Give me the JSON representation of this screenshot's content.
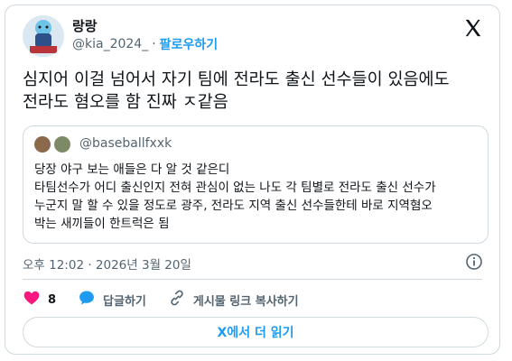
{
  "author": {
    "name": "랑랑",
    "handle": "@kia_2024_",
    "separator": "·",
    "follow_label": "팔로우하기"
  },
  "tweet": {
    "text": "심지어 이걸 넘어서 자기 팀에 전라도 출신 선수들이 있음에도\n전라도 혐오를 함 진짜 ㅈ같음"
  },
  "quote": {
    "handle": "@baseballfxxk",
    "text": "당장 야구 보는 애들은 다 알 것 같은디\n타팀선수가 어디 출신인지 전혀 관심이 없는 나도 각 팀별로 전라도 출신 선수가\n누군지 말 할 수 있을 정도로 광주, 전라도 지역 출신 선수들한테 바로 지역혐오\n박는 새끼들이 한트럭은 됨"
  },
  "meta": {
    "timestamp": "오후 12:02 · 2026년 3월 20일"
  },
  "actions": {
    "like_count": "8",
    "reply_label": "답글하기",
    "copy_link_label": "게시물 링크 복사하기"
  },
  "read_more_label": "X에서 더 읽기",
  "colors": {
    "accent": "#1d9bf0",
    "like": "#f91880",
    "muted": "#536471",
    "border": "#cfd9de"
  }
}
